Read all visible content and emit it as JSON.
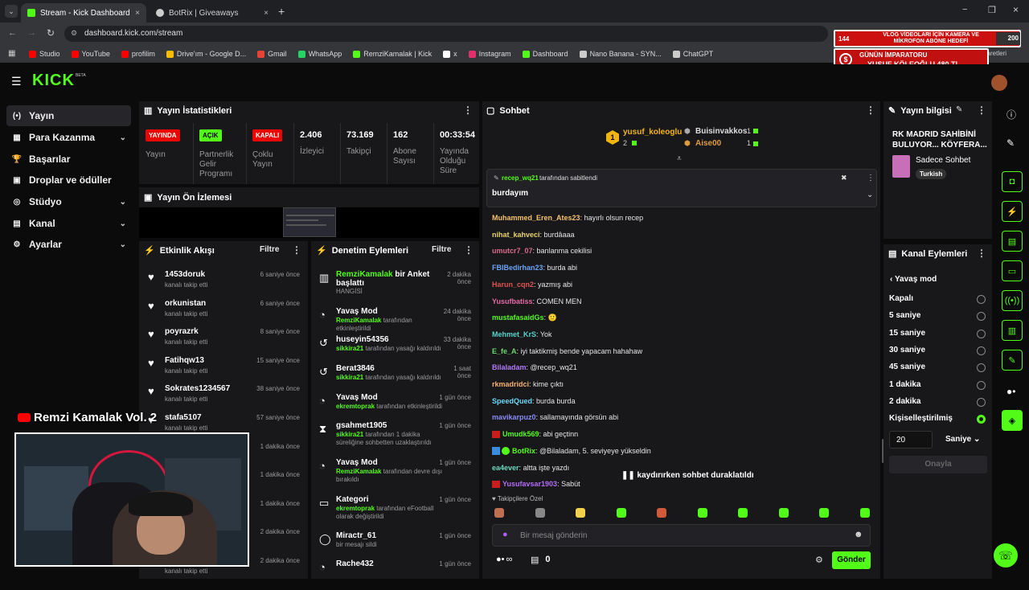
{
  "browser": {
    "tabs": [
      {
        "title": "Stream - Kick Dashboard",
        "close": "×"
      },
      {
        "title": "BotRix | Giveaways",
        "close": "×"
      }
    ],
    "new_tab": "+",
    "url": "dashboard.kick.com/stream",
    "window_controls": [
      "−",
      "❐",
      "×"
    ],
    "bookmarks": [
      {
        "label": "Studio",
        "color": "#ff0000"
      },
      {
        "label": "YouTube",
        "color": "#ff0000"
      },
      {
        "label": "profilim",
        "color": "#ff0000"
      },
      {
        "label": "Drive'ım - Google D...",
        "color": "#fbbc04"
      },
      {
        "label": "Gmail",
        "color": "#ea4335"
      },
      {
        "label": "WhatsApp",
        "color": "#25d366"
      },
      {
        "label": "RemziKamalak | Kick",
        "color": "#53fc18"
      },
      {
        "label": "x",
        "color": "#ffffff"
      },
      {
        "label": "Instagram",
        "color": "#e1306c"
      },
      {
        "label": "Dashboard",
        "color": "#53fc18"
      },
      {
        "label": "Nano Banana - SYN...",
        "color": "#cccccc"
      },
      {
        "label": "ChatGPT",
        "color": "#cccccc"
      }
    ],
    "bookmarks_right": "er İşaretleri"
  },
  "overlay": {
    "goal_count": "144",
    "goal_text": "VLOG VİDEOLARI İÇİN KAMERA VE MİKROFON ABONE HEDEFİ",
    "goal_target": "200",
    "emperor_title": "GÜNÜN İMPARATORU",
    "emperor_name": "YUSUF KÖLEOĞLU 480 TL",
    "emperor_symbol": "$",
    "webcam_label": "Remzi Kamalak Vol. 2"
  },
  "logo": "KICK",
  "logo_sup": "BETA",
  "sidebar": [
    {
      "label": "Yayın",
      "icon": "(•)",
      "chevron": false
    },
    {
      "label": "Para Kazanma",
      "icon": "▦",
      "chevron": true
    },
    {
      "label": "Başarılar",
      "icon": "🏆",
      "chevron": false
    },
    {
      "label": "Droplar ve ödüller",
      "icon": "▣",
      "chevron": false
    },
    {
      "label": "Stüdyo",
      "icon": "◎",
      "chevron": true
    },
    {
      "label": "Kanal",
      "icon": "▤",
      "chevron": true
    },
    {
      "label": "Ayarlar",
      "icon": "⚙",
      "chevron": true
    }
  ],
  "stats": {
    "title": "Yayın İstatistikleri",
    "badges": [
      {
        "badge": "YAYINDA",
        "label": "Yayın"
      },
      {
        "badge": "AÇIK",
        "label": "Partnerlik Gelir Programı"
      },
      {
        "badge": "KAPALI",
        "label": "Çoklu Yayın"
      }
    ],
    "numbers": [
      {
        "value": "2.406",
        "label": "İzleyici"
      },
      {
        "value": "73.169",
        "label": "Takipçi"
      },
      {
        "value": "162",
        "label": "Abone Sayısı"
      },
      {
        "value": "00:33:54",
        "label": "Yayında Olduğu Süre"
      }
    ]
  },
  "preview": {
    "title": "Yayın Ön İzlemesi"
  },
  "activity": {
    "title": "Etkinlik Akışı",
    "filter": "Filtre",
    "items": [
      {
        "name": "1453doruk",
        "sub": "kanalı takip etti",
        "time": "6 saniye önce"
      },
      {
        "name": "orkunistan",
        "sub": "kanalı takip etti",
        "time": "6 saniye önce"
      },
      {
        "name": "poyrazrk",
        "sub": "kanalı takip etti",
        "time": "8 saniye önce"
      },
      {
        "name": "Fatihqw13",
        "sub": "kanalı takip etti",
        "time": "15 saniye önce"
      },
      {
        "name": "Sokrates1234567",
        "sub": "kanalı takip etti",
        "time": "38 saniye önce"
      },
      {
        "name": "stafa5107",
        "sub": "kanalı takip etti",
        "time": "57 saniye önce"
      },
      {
        "name": "",
        "sub": "",
        "time": "1 dakika önce"
      },
      {
        "name": "",
        "sub": "",
        "time": "1 dakika önce"
      },
      {
        "name": "",
        "sub": "",
        "time": "1 dakika önce"
      },
      {
        "name": "",
        "sub": "",
        "time": "2 dakika önce"
      },
      {
        "name": "",
        "sub": "kanalı takip etti",
        "time": "2 dakika önce"
      }
    ]
  },
  "moderation": {
    "title": "Denetim Eylemleri",
    "filter": "Filtre",
    "items": [
      {
        "icon": "▥",
        "title_green": "RemziKamalak",
        "title": " bir Anket başlattı",
        "sub_green": "",
        "sub": "HANGİSİ",
        "time": "2 dakika önce"
      },
      {
        "icon": "◔",
        "title_green": "",
        "title": "Yavaş Mod",
        "sub_green": "RemziKamalak",
        "sub": " tarafından etkinleştirildi",
        "time": "24 dakika önce"
      },
      {
        "icon": "↺",
        "title_green": "",
        "title": "huseyin54356",
        "sub_green": "sikkira21",
        "sub": " tarafından yasağı kaldırıldı",
        "time": "33 dakika önce"
      },
      {
        "icon": "↺",
        "title_green": "",
        "title": "Berat3846",
        "sub_green": "sikkira21",
        "sub": " tarafından yasağı kaldırıldı",
        "time": "1 saat önce"
      },
      {
        "icon": "◔",
        "title_green": "",
        "title": "Yavaş Mod",
        "sub_green": "ekremtoprak",
        "sub": " tarafından etkinleştirildi",
        "time": "1 gün önce"
      },
      {
        "icon": "⧗",
        "title_green": "",
        "title": "gsahmet1905",
        "sub_green": "sikkira21",
        "sub": " tarafından 1 dakika süreliğine sohbetten uzaklaştırıldı",
        "time": "1 gün önce"
      },
      {
        "icon": "◔",
        "title_green": "",
        "title": "Yavaş Mod",
        "sub_green": "RemziKamalak",
        "sub": " tarafından devre dışı bırakıldı",
        "time": "1 gün önce"
      },
      {
        "icon": "▭",
        "title_green": "",
        "title": "Kategori",
        "sub_green": "ekremtoprak",
        "sub": " tarafından eFootball olarak değiştirildi",
        "time": "1 gün önce"
      },
      {
        "icon": "◯",
        "title_green": "",
        "title": "Miractr_61",
        "sub_green": "",
        "sub": "bir mesajı sildi",
        "time": "1 gün önce"
      },
      {
        "icon": "◔",
        "title_green": "",
        "title": "Rache432",
        "sub_green": "",
        "sub": "",
        "time": "1 gün önce"
      }
    ]
  },
  "chat": {
    "title": "Sohbet",
    "leaders": [
      {
        "rank": "1",
        "name": "yusuf_koleoglu",
        "count": "2"
      },
      {
        "rank": "",
        "name": "Buisinvakkos",
        "count": "1"
      },
      {
        "rank": "",
        "name": "Aise00",
        "count": "1"
      }
    ],
    "pinned_by": "recep_wq21",
    "pinned_suffix": " tarafından sabitlendi",
    "pinned_msg": "burdayım",
    "messages": [
      {
        "user": "Muhammed_Eren_Ates23",
        "color": "#f5c26b",
        "text": "hayırlı olsun recep"
      },
      {
        "user": "nihat_kahveci",
        "color": "#e8d36b",
        "text": "burdâaaa"
      },
      {
        "user": "umutcr7_07",
        "color": "#d96b8a",
        "text": "banlanma cekilisi"
      },
      {
        "user": "FBIBedirhan23",
        "color": "#6ba3f5",
        "text": "burda abi"
      },
      {
        "user": "Harun_cqn2",
        "color": "#e05252",
        "text": "yazmış abi"
      },
      {
        "user": "Yusufbatiss",
        "color": "#e46ba6",
        "text": "COMEN MEN"
      },
      {
        "user": "mustafasaidGs",
        "color": "#53fc18",
        "text": "🙂"
      },
      {
        "user": "Mehmet_KrS",
        "color": "#57d3c9",
        "text": "Yok"
      },
      {
        "user": "E_fe_A",
        "color": "#6bd96b",
        "text": "iyi taktikmiş bende yapacam hahahaw"
      },
      {
        "user": "Bilaladam",
        "color": "#b07af5",
        "text": "@recep_wq21"
      },
      {
        "user": "rkmadridci",
        "color": "#f5b26b",
        "text": "kime çıktı"
      },
      {
        "user": "SpeedQued",
        "color": "#6bd9f5",
        "text": "burda burda"
      },
      {
        "user": "mavikarpuz0",
        "color": "#8a8af5",
        "text": "sallamayında görsün abi"
      },
      {
        "user": "Umudk569",
        "color": "#53fc18",
        "text": "abi geçtinn"
      },
      {
        "user": "BotRix",
        "color": "#53fc18",
        "text": "@Bilaladam, 5. seviyeye yükseldin"
      },
      {
        "user": "ea4ever",
        "color": "#6bd9c0",
        "text": "altta işte yazdı"
      },
      {
        "user": "Yusufavsar1903",
        "color": "#b46bf5",
        "text": "Sabüt"
      }
    ],
    "paused": "kaydırırken sohbet duraklatıldı",
    "followers_only": "Takipçilere Özel",
    "input_placeholder": "Bir mesaj gönderin",
    "points": "0",
    "infinity": "∞",
    "send": "Gönder"
  },
  "info": {
    "title": "Yayın bilgisi",
    "stream_title": "RK MADRID SAHİBİNİ BULUYOR... KÖYFERA...",
    "category": "Sadece Sohbet",
    "tag": "Turkish"
  },
  "channel_actions": {
    "title": "Kanal Eylemleri",
    "back_label": "Yavaş mod",
    "options": [
      "Kapalı",
      "5 saniye",
      "15 saniye",
      "30 saniye",
      "45 saniye",
      "1 dakika",
      "2 dakika",
      "Kişiselleştirilmiş"
    ],
    "selected_index": 7,
    "custom_value": "20",
    "unit": "Saniye",
    "confirm": "Onayla"
  },
  "colors": {
    "accent": "#53fc18",
    "live": "#eb0400",
    "panel": "#18181b"
  }
}
